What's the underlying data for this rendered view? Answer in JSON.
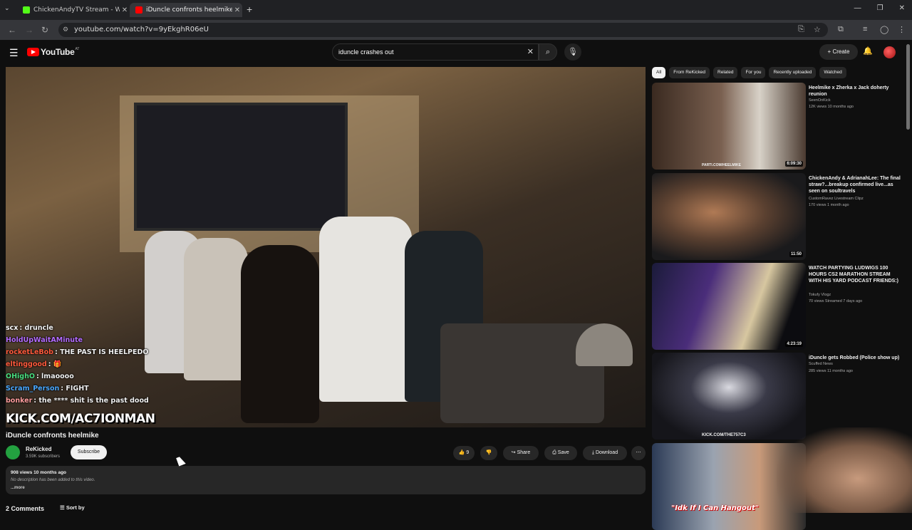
{
  "browser": {
    "tabs": [
      {
        "label": "ChickenAndyTV Stream - Watch",
        "color": "#53fc18"
      },
      {
        "label": "iDuncle confronts heelmike - Yo",
        "color": "#ff0000"
      }
    ],
    "url": "youtube.com/watch?v=9yEkghR06eU"
  },
  "header": {
    "logo_text": "YouTube",
    "logo_country": "AT",
    "search_value": "iduncle crashes out",
    "create_label": "Create"
  },
  "chat": [
    {
      "user": "scx",
      "msg": ": druncle",
      "color": "#ffffff"
    },
    {
      "user": "HoldUpWaitAMinute",
      "msg": "",
      "color": "#b46cff"
    },
    {
      "user": "rocketLeBob",
      "msg": ": THE PAST IS HEELPEDO",
      "color": "#ff5a3c"
    },
    {
      "user": "eltinggood",
      "msg": ": 🎁",
      "color": "#ff5a3c"
    },
    {
      "user": "OHighO",
      "msg": ": lmaoooo",
      "color": "#4ade80"
    },
    {
      "user": "Scram_Person",
      "msg": ": FIGHT",
      "color": "#4aa8ff"
    },
    {
      "user": "bonker",
      "msg": ": the **** shit is the past dood",
      "color": "#ff9d9d"
    }
  ],
  "watermark": "KICK.COM/AC7IONMAN",
  "video": {
    "title": "iDuncle confronts heelmike",
    "channel": "ReKicked",
    "subscribers": "3.59K subscribers",
    "subscribe_label": "Subscribe",
    "likes": "9",
    "share_label": "Share",
    "save_label": "Save",
    "download_label": "Download",
    "views_date": "908 views  10 months ago",
    "no_description": "No description has been added to this video.",
    "more_label": "...more",
    "comments_count": "2 Comments",
    "sort_label": "Sort by"
  },
  "chips": [
    "All",
    "From ReKicked",
    "Related",
    "For you",
    "Recently uploaded",
    "Watched"
  ],
  "recommendations": [
    {
      "title": "Heelmike x Zherka x Jack doherty reunion",
      "channel": "SeenOnKick",
      "meta": "12K views  10 months ago",
      "duration": "6:09:30",
      "thumb_caption": "PARTI.COM/HEELMIKE"
    },
    {
      "title": "ChickenAndy & AdrianahLee: The final straw?...breakup confirmed live...as seen on soultravels",
      "channel": "CustomRavez Livestream Clipz",
      "meta": "170 views  1 month ago",
      "duration": "11:50",
      "thumb_caption": ""
    },
    {
      "title": "WATCH PARTYING LUDWIGS 100 HOURS CS2 MARATHON STREAM WITH HIS YARD PODCAST FRIENDS:)",
      "channel": "Tokufy Vlogz",
      "meta": "70 views  Streamed 7 days ago",
      "duration": "4:23:19",
      "thumb_caption": ""
    },
    {
      "title": "iDuncle gets Robbed (Police show up)",
      "channel": "Scuffed News",
      "meta": "285 views  11 months ago",
      "duration": "",
      "thumb_caption": "KICK.COM/THE757C3"
    }
  ],
  "overlay_caption": "\"Idk If I Can Hangout\""
}
